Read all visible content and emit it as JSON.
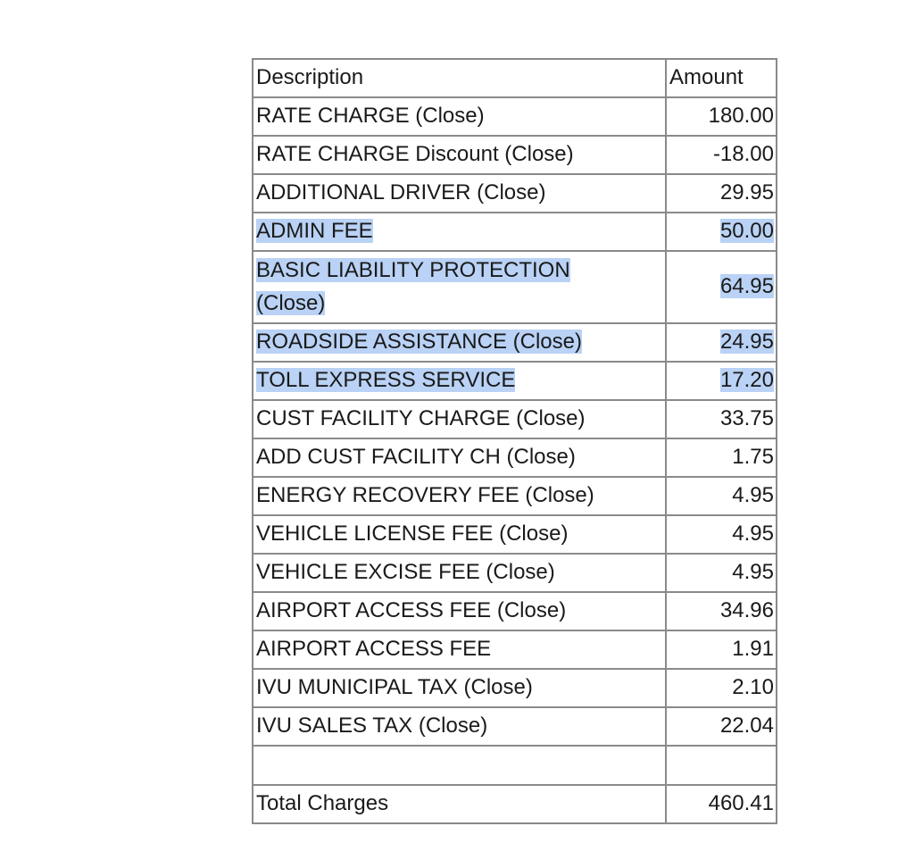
{
  "table": {
    "headers": {
      "description": "Description",
      "amount": "Amount"
    },
    "rows": [
      {
        "description": "RATE CHARGE (Close)",
        "amount": "180.00",
        "highlighted": false
      },
      {
        "description": "RATE CHARGE Discount (Close)",
        "amount": "-18.00",
        "highlighted": false
      },
      {
        "description": "ADDITIONAL DRIVER (Close)",
        "amount": "29.95",
        "highlighted": false
      },
      {
        "description": "ADMIN FEE",
        "amount": "50.00",
        "highlighted": true
      },
      {
        "description_line1": "BASIC LIABILITY PROTECTION",
        "description_line2": "(Close)",
        "amount": "64.95",
        "highlighted": true
      },
      {
        "description": "ROADSIDE ASSISTANCE (Close)",
        "amount": "24.95",
        "highlighted": true
      },
      {
        "description": "TOLL EXPRESS SERVICE",
        "amount": "17.20",
        "highlighted": true
      },
      {
        "description": "CUST FACILITY CHARGE (Close)",
        "amount": "33.75",
        "highlighted": false
      },
      {
        "description": "ADD CUST FACILITY CH (Close)",
        "amount": "1.75",
        "highlighted": false
      },
      {
        "description": "ENERGY RECOVERY FEE (Close)",
        "amount": "4.95",
        "highlighted": false
      },
      {
        "description": "VEHICLE LICENSE FEE (Close)",
        "amount": "4.95",
        "highlighted": false
      },
      {
        "description": "VEHICLE EXCISE FEE (Close)",
        "amount": "4.95",
        "highlighted": false
      },
      {
        "description": "AIRPORT ACCESS FEE (Close)",
        "amount": "34.96",
        "highlighted": false
      },
      {
        "description": "AIRPORT ACCESS FEE",
        "amount": "1.91",
        "highlighted": false
      },
      {
        "description": "IVU MUNICIPAL TAX (Close)",
        "amount": "2.10",
        "highlighted": false
      },
      {
        "description": "IVU SALES TAX (Close)",
        "amount": "22.04",
        "highlighted": false
      }
    ],
    "total": {
      "label": "Total Charges",
      "amount": "460.41"
    }
  },
  "colors": {
    "selection_highlight": "#b9d2f5",
    "border": "#8a8a8a"
  }
}
